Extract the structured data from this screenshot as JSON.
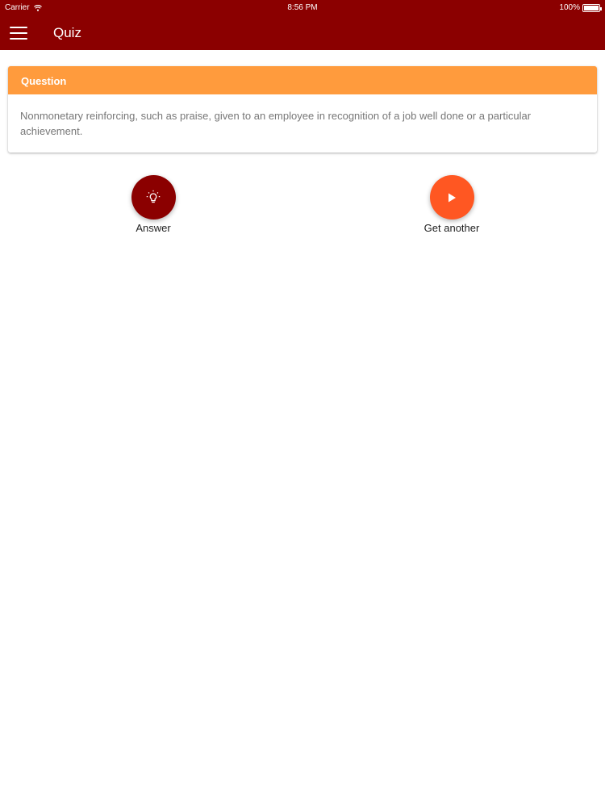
{
  "status_bar": {
    "carrier": "Carrier",
    "time": "8:56 PM",
    "battery": "100%"
  },
  "toolbar": {
    "title": "Quiz"
  },
  "question_card": {
    "header": "Question",
    "text": "Nonmonetary reinforcing, such as praise, given to an employee in recognition of a job well done or a particular achievement."
  },
  "actions": {
    "answer_label": "Answer",
    "get_another_label": "Get another"
  },
  "icons": {
    "menu": "hamburger-menu-icon",
    "answer": "lightbulb-icon",
    "get_another": "play-icon",
    "wifi": "wifi-icon",
    "battery": "battery-icon"
  },
  "colors": {
    "app_bar": "#8b0000",
    "card_header": "#ff9b3d",
    "answer_button": "#8b0000",
    "get_another_button": "#ff5722"
  }
}
